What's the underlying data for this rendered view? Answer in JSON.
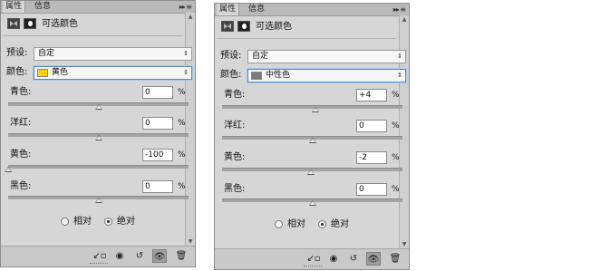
{
  "panels": [
    {
      "tabs": [
        "属性",
        "信息"
      ],
      "header_title": "可选颜色",
      "preset_label": "预设:",
      "preset_value": "自定",
      "colors_label": "颜色:",
      "colors_value": "黄色",
      "swatch_color": "#ffd000",
      "sliders": [
        {
          "label": "青色:",
          "value": "0",
          "unit": "%",
          "level": 0
        },
        {
          "label": "洋红:",
          "value": "0",
          "unit": "%",
          "level": 0
        },
        {
          "label": "黄色:",
          "value": "-100",
          "unit": "%",
          "level": -100
        },
        {
          "label": "黑色:",
          "value": "0",
          "unit": "%",
          "level": 0
        }
      ],
      "radio_relative": "相对",
      "radio_absolute": "绝对",
      "selected_method": "absolute"
    },
    {
      "tabs": [
        "属性",
        "信息"
      ],
      "header_title": "可选颜色",
      "preset_label": "预设:",
      "preset_value": "自定",
      "colors_label": "颜色:",
      "colors_value": "中性色",
      "swatch_color": "#7a7a7a",
      "sliders": [
        {
          "label": "青色:",
          "value": "+4",
          "unit": "%",
          "level": 4
        },
        {
          "label": "洋红:",
          "value": "0",
          "unit": "%",
          "level": 0
        },
        {
          "label": "黄色:",
          "value": "-2",
          "unit": "%",
          "level": -2
        },
        {
          "label": "黑色:",
          "value": "0",
          "unit": "%",
          "level": 0
        }
      ],
      "radio_relative": "相对",
      "radio_absolute": "绝对",
      "selected_method": "absolute"
    }
  ],
  "footer_icons": [
    "clip-to-layer-icon",
    "view-previous-state-icon",
    "reset-icon",
    "toggle-visibility-icon",
    "delete-icon"
  ]
}
